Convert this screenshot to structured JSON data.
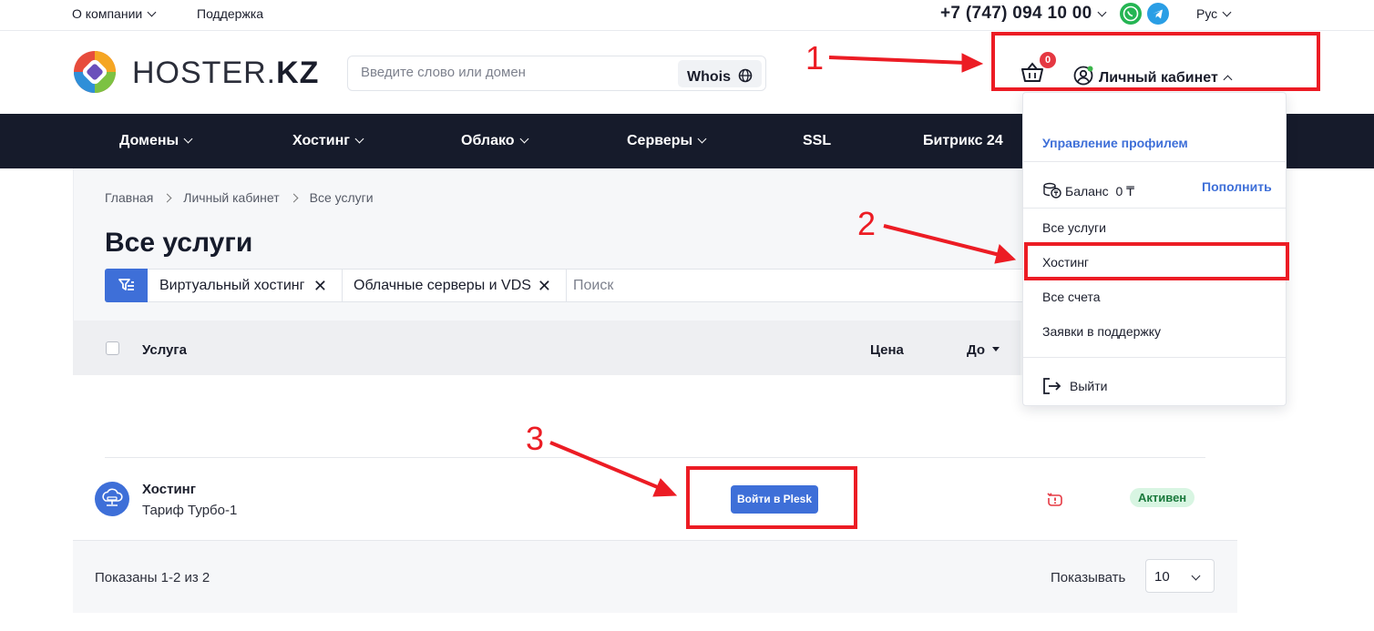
{
  "topbar": {
    "about": "О компании",
    "support": "Поддержка",
    "phone": "+7 (747) 094 10 00",
    "lang": "Рус"
  },
  "header": {
    "logo_text_light": "HOSTER.",
    "logo_text_bold": "KZ",
    "search_placeholder": "Введите слово или домен",
    "whois_label": "Whois",
    "cart_count": "0",
    "account_label": "Личный кабинет"
  },
  "nav": {
    "items": [
      "Домены",
      "Хостинг",
      "Облако",
      "Серверы",
      "SSL",
      "Битрикс 24"
    ]
  },
  "breadcrumb": [
    "Главная",
    "Личный кабинет",
    "Все услуги"
  ],
  "page_title": "Все услуги",
  "filters": {
    "chips": [
      "Виртуальный хостинг",
      "Облачные серверы и VDS"
    ],
    "search_placeholder": "Поиск"
  },
  "table": {
    "headers": {
      "service": "Услуга",
      "price": "Цена",
      "until": "До"
    },
    "rows": [
      {
        "name": "Хостинг",
        "plan": "Тариф Турбо-1",
        "action": "Войти в Plesk",
        "status": "Активен"
      }
    ]
  },
  "pagination": {
    "shown": "Показаны 1-2 из 2",
    "per_page_label": "Показывать",
    "per_page_value": "10"
  },
  "account_menu": {
    "manage_profile": "Управление профилем",
    "balance_label": "Баланс",
    "balance_value": "0 ₸",
    "top_up": "Пополнить",
    "items": [
      "Все услуги",
      "Хостинг",
      "Все счета",
      "Заявки в поддержку"
    ],
    "logout": "Выйти"
  },
  "annotations": [
    "1",
    "2",
    "3"
  ],
  "colors": {
    "accent": "#3e6fd8",
    "nav_bg": "#161b2b",
    "annotation": "#ec1c24",
    "status_bg": "#d8f5e2"
  }
}
